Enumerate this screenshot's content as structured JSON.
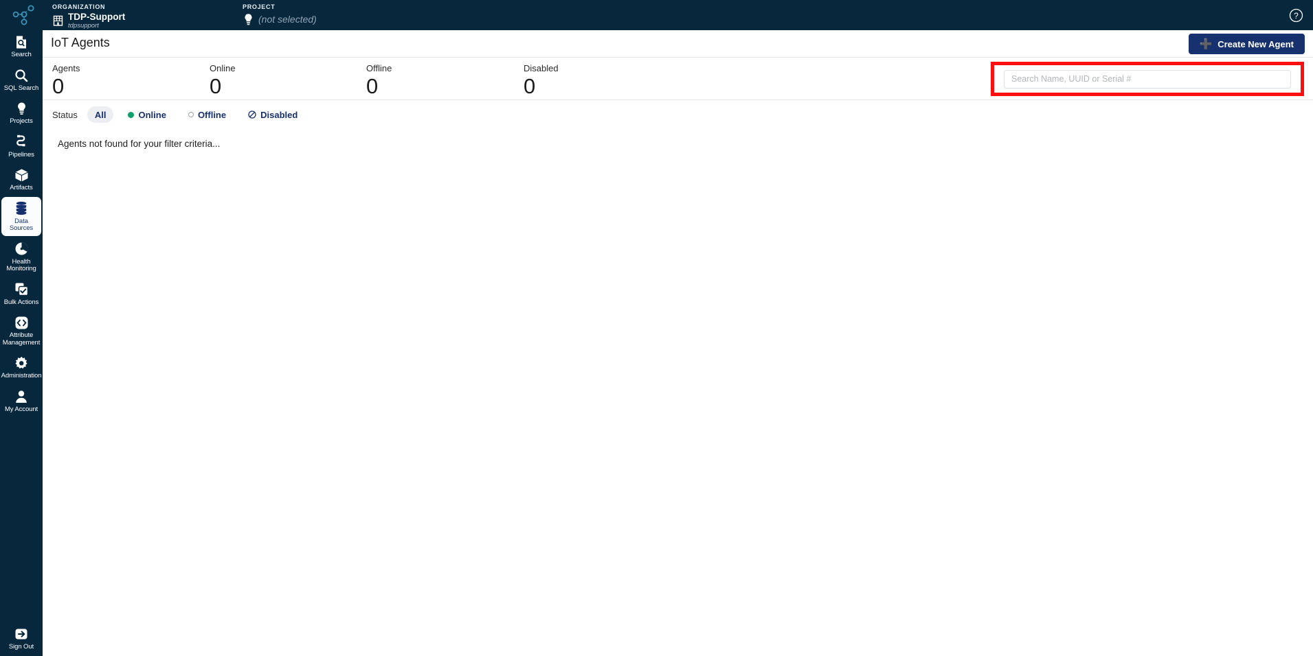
{
  "topbar": {
    "logo_icon": "network-nodes-logo",
    "organization": {
      "kicker": "ORGANIZATION",
      "icon": "building-icon",
      "name": "TDP-Support",
      "slug": "tdpsupport"
    },
    "project": {
      "kicker": "PROJECT",
      "icon": "lightbulb-icon",
      "value": "(not selected)"
    },
    "help_icon": "help-circle-icon"
  },
  "sidebar": {
    "items": [
      {
        "label": "Search",
        "icon": "document-search-icon",
        "active": false
      },
      {
        "label": "SQL Search",
        "icon": "magnifier-icon",
        "active": false
      },
      {
        "label": "Projects",
        "icon": "lightbulb-icon",
        "active": false
      },
      {
        "label": "Pipelines",
        "icon": "pipeline-icon",
        "active": false
      },
      {
        "label": "Artifacts",
        "icon": "cube-icon",
        "active": false
      },
      {
        "label": "Data Sources",
        "icon": "database-icon",
        "active": true
      },
      {
        "label": "Health\nMonitoring",
        "icon": "health-gauge-icon",
        "active": false
      },
      {
        "label": "Bulk Actions",
        "icon": "checkbox-stack-icon",
        "active": false
      },
      {
        "label": "Attribute\nManagement",
        "icon": "code-brackets-icon",
        "active": false
      },
      {
        "label": "Administration",
        "icon": "gear-icon",
        "active": false
      },
      {
        "label": "My Account",
        "icon": "person-icon",
        "active": false
      }
    ],
    "signout": {
      "label": "Sign Out",
      "icon": "sign-out-icon"
    }
  },
  "page": {
    "title": "IoT Agents",
    "create_button": {
      "label": "Create New Agent",
      "icon": "plus-icon"
    }
  },
  "stats": [
    {
      "label": "Agents",
      "value": "0"
    },
    {
      "label": "Online",
      "value": "0"
    },
    {
      "label": "Offline",
      "value": "0"
    },
    {
      "label": "Disabled",
      "value": "0"
    }
  ],
  "search": {
    "placeholder": "Search Name, UUID or Serial #",
    "value": "",
    "annotation_color": "#ff0f0f"
  },
  "filters": {
    "label": "Status",
    "options": [
      {
        "label": "All",
        "marker": "none",
        "selected": true
      },
      {
        "label": "Online",
        "marker": "dot-green",
        "selected": false
      },
      {
        "label": "Offline",
        "marker": "dot-outline",
        "selected": false
      },
      {
        "label": "Disabled",
        "marker": "blocked-icon",
        "selected": false
      }
    ]
  },
  "content": {
    "empty_message": "Agents not found for your filter criteria..."
  },
  "colors": {
    "navy_chrome": "#07273d",
    "brand_blue": "#17306e",
    "online_green": "#0e9f6e",
    "annotation_red": "#ff0f0f"
  }
}
